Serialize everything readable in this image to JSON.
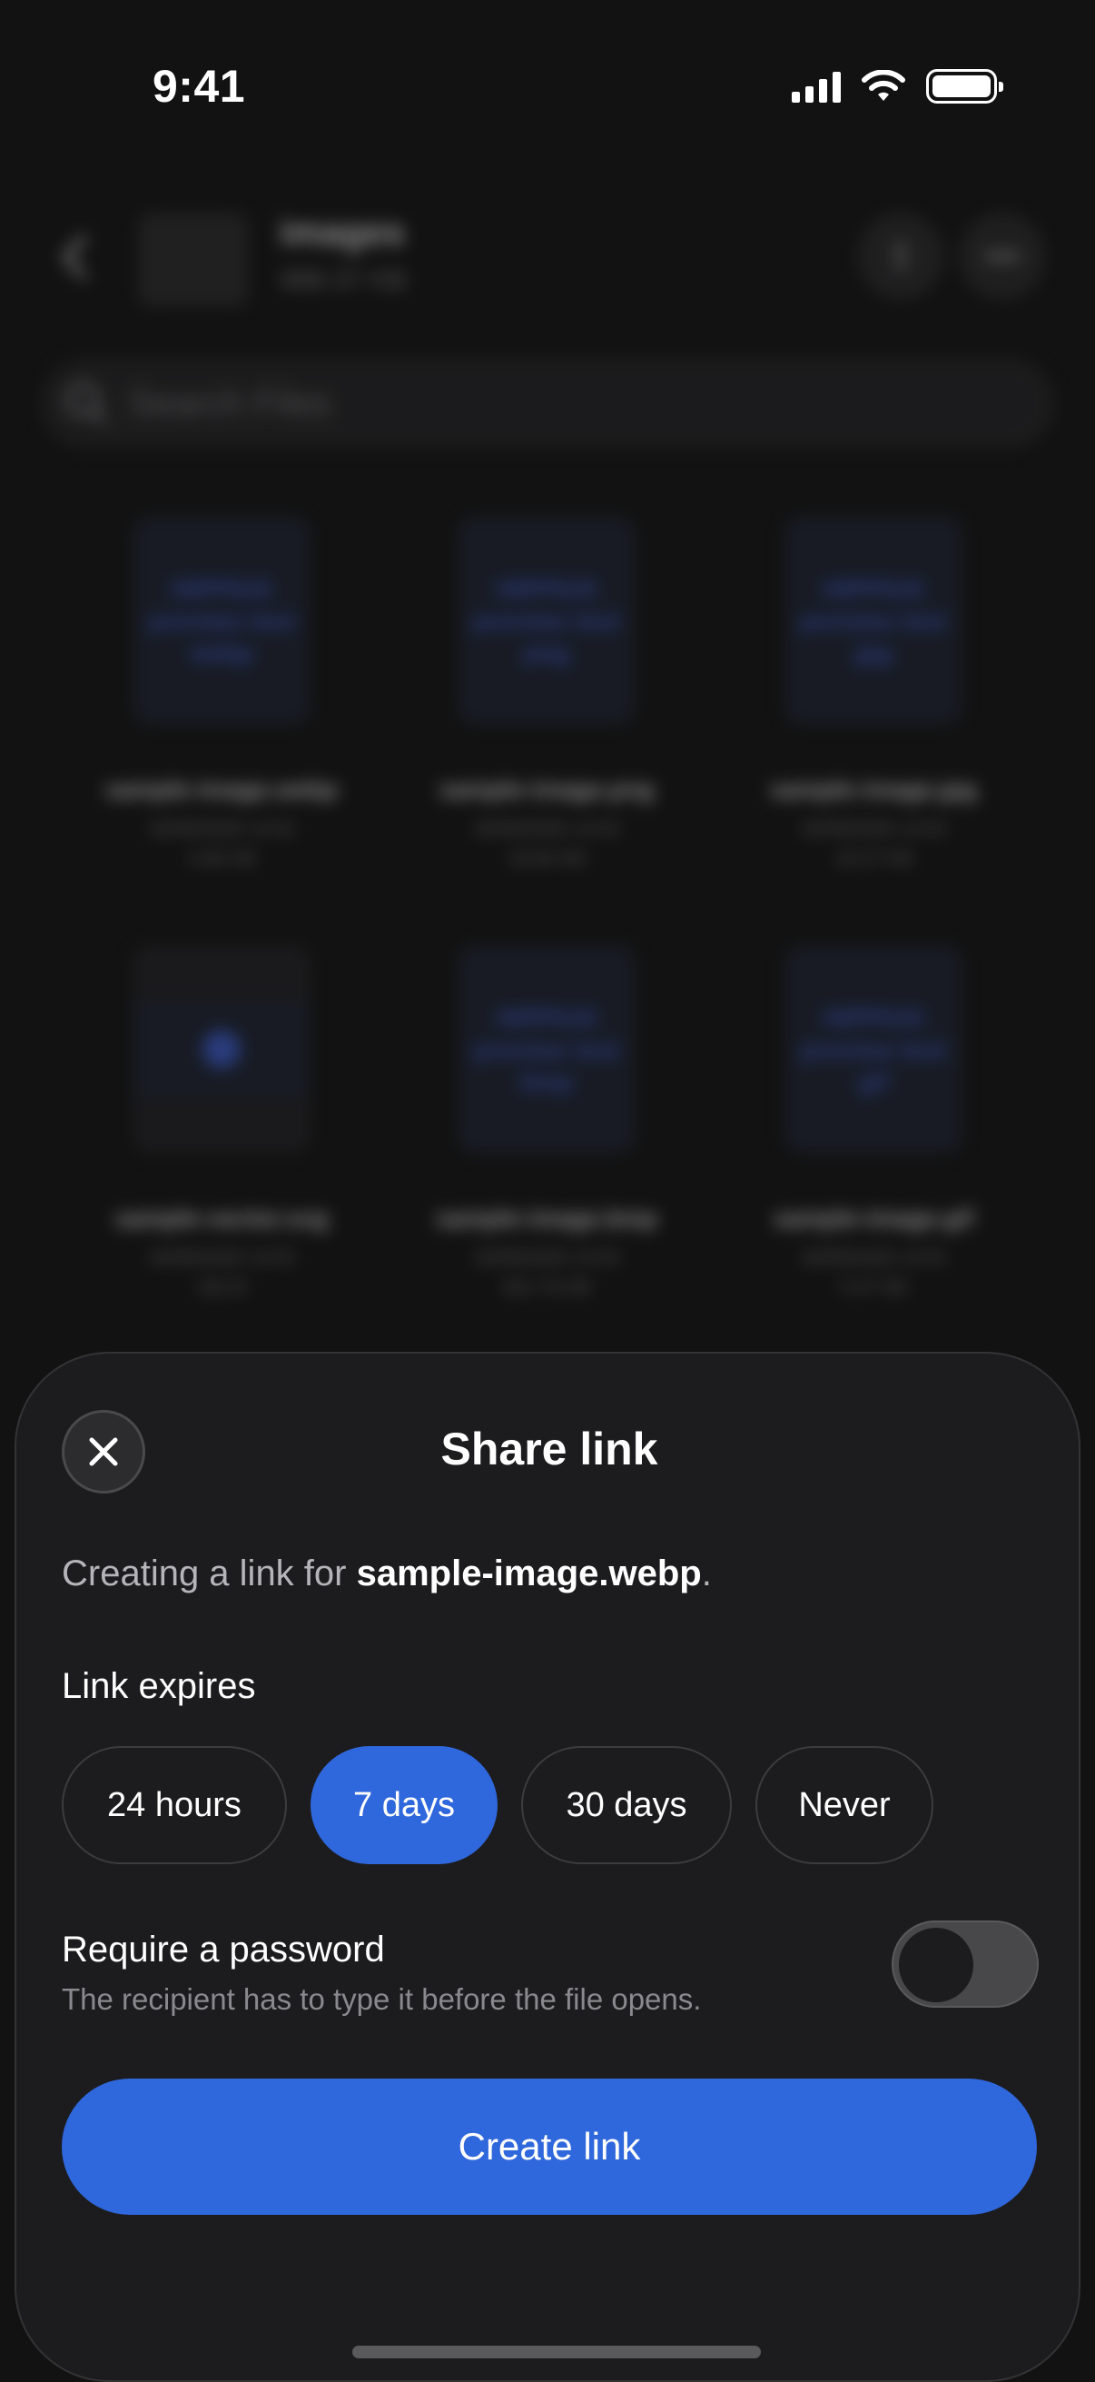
{
  "status_bar": {
    "time": "9:41"
  },
  "header": {
    "title": "images",
    "size": "988.37 KB"
  },
  "search": {
    "placeholder": "Search Files"
  },
  "files": [
    {
      "name": "sample-image.webp",
      "date": "16/09/2026 14:52",
      "size": "4.66 KB",
      "thumb_text": "HIPPIUS preview test webp"
    },
    {
      "name": "sample-image.png",
      "date": "16/09/2026 14:52",
      "size": "19.84 KB",
      "thumb_text": "HIPPIUS preview test png"
    },
    {
      "name": "sample-image.jpg",
      "date": "16/09/2026 14:52",
      "size": "19.27 KB",
      "thumb_text": "HIPPIUS preview test jpg"
    },
    {
      "name": "sample-vector.svg",
      "date": "16/09/2026 14:52",
      "size": "332 B",
      "thumb_text": ""
    },
    {
      "name": "sample-image.bmp",
      "date": "16/09/2026 14:52",
      "size": "931.76 KB",
      "thumb_text": "HIPPIUS preview test bmp"
    },
    {
      "name": "sample-image.gif",
      "date": "16/09/2026 14:51",
      "size": "5.47 KB",
      "thumb_text": "HIPPIUS preview test gif"
    }
  ],
  "sheet": {
    "title": "Share link",
    "desc_prefix": "Creating a link for ",
    "desc_file": "sample-image.webp",
    "desc_suffix": ".",
    "expires_label": "Link expires",
    "expiry_options": [
      "24 hours",
      "7 days",
      "30 days",
      "Never"
    ],
    "selected_expiry": "7 days",
    "password_label": "Require a password",
    "password_sub": "The recipient has to type it before the file opens.",
    "password_enabled": false,
    "create_label": "Create link"
  },
  "colors": {
    "accent": "#2f67dc",
    "sheet_bg": "#1c1c1e",
    "background": "#121212"
  },
  "icons": [
    "back-icon",
    "upload-icon",
    "more-icon",
    "search-icon",
    "close-icon"
  ]
}
